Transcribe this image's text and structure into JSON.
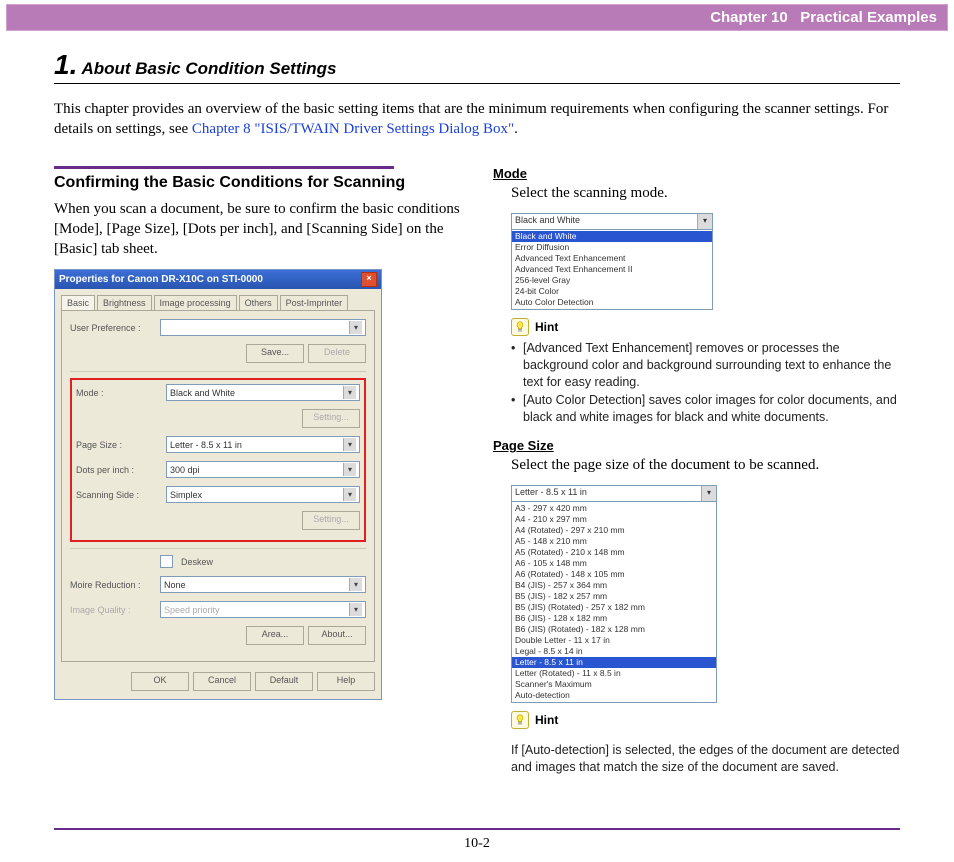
{
  "header": {
    "chapter": "Chapter 10",
    "title": "Practical Examples"
  },
  "heading": {
    "number": "1.",
    "text": "About Basic Condition Settings"
  },
  "intro": {
    "pre": "This chapter provides an overview of the basic setting items that are the minimum requirements when configuring the scanner settings. For details on settings, see ",
    "link": "Chapter 8 \"ISIS/TWAIN Driver Settings Dialog Box\"",
    "post": "."
  },
  "left": {
    "subhead": "Confirming the Basic Conditions for Scanning",
    "body": "When you scan a document, be sure to confirm the basic conditions [Mode], [Page Size], [Dots per inch], and [Scanning Side] on the [Basic] tab sheet."
  },
  "dialog": {
    "title": "Properties for Canon DR-X10C on STI-0000",
    "tabs": [
      "Basic",
      "Brightness",
      "Image processing",
      "Others",
      "Post-Imprinter"
    ],
    "labels": {
      "userpref": "User Preference :",
      "save": "Save...",
      "delete": "Delete",
      "mode": "Mode :",
      "setting": "Setting...",
      "pagesize": "Page Size :",
      "dpi": "Dots per inch :",
      "scanside": "Scanning Side :",
      "deskew": "Deskew",
      "moire": "Moire Reduction :",
      "quality": "Image Quality :",
      "area": "Area...",
      "about": "About...",
      "ok": "OK",
      "cancel": "Cancel",
      "default": "Default",
      "help": "Help"
    },
    "values": {
      "userpref": "",
      "mode": "Black and White",
      "pagesize": "Letter - 8.5 x 11 in",
      "dpi": "300 dpi",
      "scanside": "Simplex",
      "moire": "None",
      "quality": "Speed priority"
    }
  },
  "right": {
    "mode": {
      "label": "Mode",
      "text": "Select the scanning mode.",
      "selected": "Black and White",
      "options": [
        "Black and White",
        "Error Diffusion",
        "Advanced Text Enhancement",
        "Advanced Text Enhancement II",
        "256-level Gray",
        "24-bit Color",
        "Auto Color Detection"
      ],
      "hint_label": "Hint",
      "hints": [
        "[Advanced Text Enhancement] removes or processes the background color and background surrounding text to enhance the text for easy reading.",
        "[Auto Color Detection] saves color images for color documents, and black and white images for black and white documents."
      ]
    },
    "pagesize": {
      "label": "Page Size",
      "text": "Select the page size of the document to be scanned.",
      "head": "Letter - 8.5 x 11 in",
      "options": [
        "A3 - 297 x 420 mm",
        "A4 - 210 x 297 mm",
        "A4 (Rotated) - 297 x 210 mm",
        "A5 - 148 x 210 mm",
        "A5 (Rotated) - 210 x 148 mm",
        "A6 - 105 x 148 mm",
        "A6 (Rotated) - 148 x 105 mm",
        "B4 (JIS) - 257 x 364 mm",
        "B5 (JIS) - 182 x 257 mm",
        "B5 (JIS) (Rotated) - 257 x 182 mm",
        "B6 (JIS) - 128 x 182 mm",
        "B6 (JIS) (Rotated) - 182 x 128 mm",
        "Double Letter - 11 x 17 in",
        "Legal - 8.5 x 14 in",
        "Letter - 8.5 x 11 in",
        "Letter (Rotated) - 11 x 8.5 in",
        "Scanner's Maximum",
        "Auto-detection"
      ],
      "selected_index": 14,
      "hint_label": "Hint",
      "hint_text": "If [Auto-detection] is selected, the edges of the document are detected and images that match the size of the document are saved."
    }
  },
  "footer": {
    "pagenum": "10-2"
  }
}
